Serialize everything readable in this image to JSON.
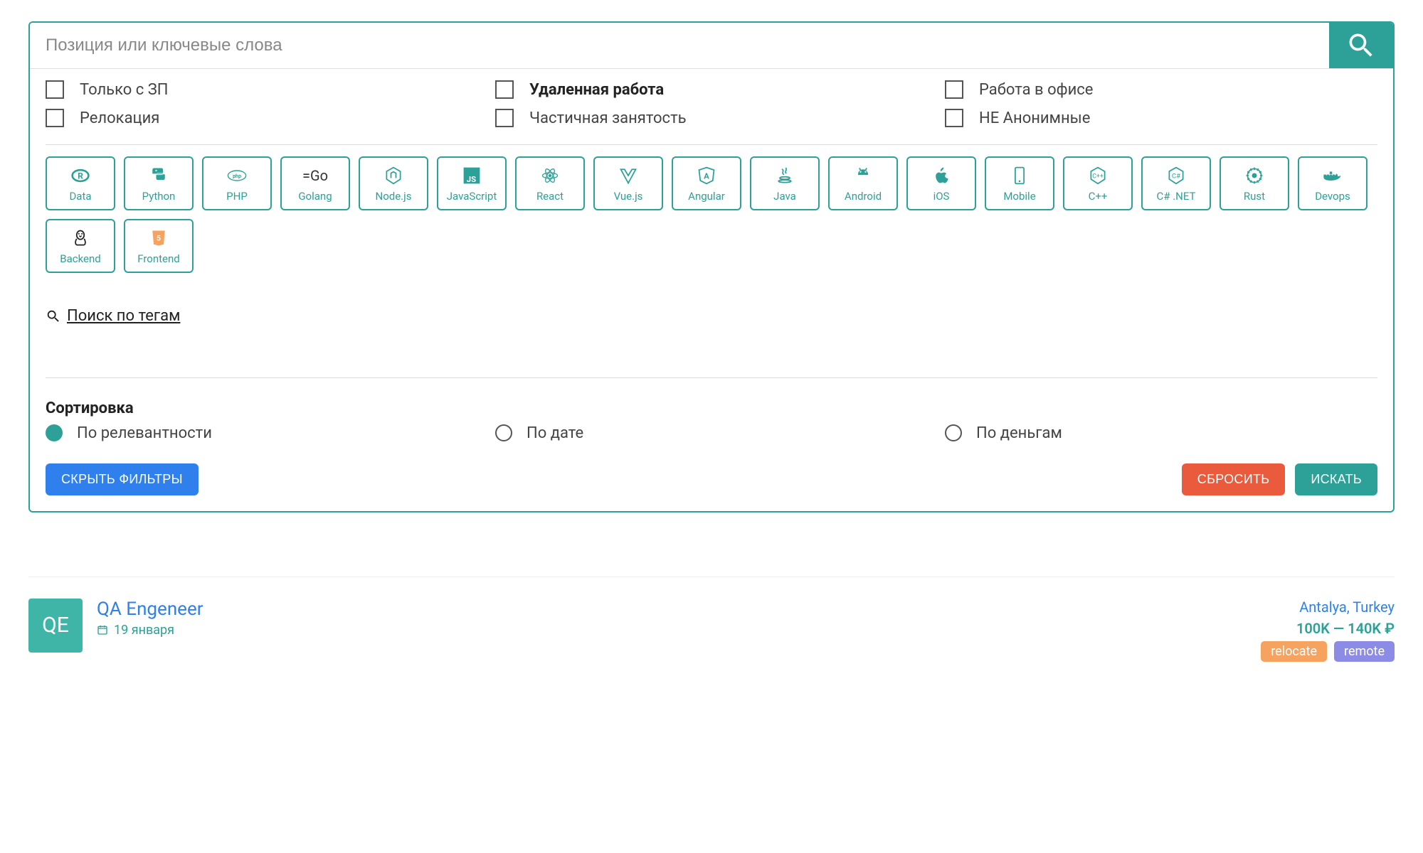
{
  "search": {
    "placeholder": "Позиция или ключевые слова"
  },
  "checkboxes": [
    {
      "label": "Только с ЗП",
      "bold": false
    },
    {
      "label": "Удаленная работа",
      "bold": true
    },
    {
      "label": "Работа в офисе",
      "bold": false
    },
    {
      "label": "Релокация",
      "bold": false
    },
    {
      "label": "Частичная занятость",
      "bold": false
    },
    {
      "label": "НЕ Анонимные",
      "bold": false
    }
  ],
  "tech": [
    {
      "label": "Data",
      "icon": "r"
    },
    {
      "label": "Python",
      "icon": "python"
    },
    {
      "label": "PHP",
      "icon": "php"
    },
    {
      "label": "Golang",
      "icon": "go"
    },
    {
      "label": "Node.js",
      "icon": "nodejs"
    },
    {
      "label": "JavaScript",
      "icon": "js"
    },
    {
      "label": "React",
      "icon": "react"
    },
    {
      "label": "Vue.js",
      "icon": "vue"
    },
    {
      "label": "Angular",
      "icon": "angular"
    },
    {
      "label": "Java",
      "icon": "java"
    },
    {
      "label": "Android",
      "icon": "android"
    },
    {
      "label": "iOS",
      "icon": "apple"
    },
    {
      "label": "Mobile",
      "icon": "mobile"
    },
    {
      "label": "C++",
      "icon": "cpp"
    },
    {
      "label": "C# .NET",
      "icon": "csharp"
    },
    {
      "label": "Rust",
      "icon": "rust"
    },
    {
      "label": "Devops",
      "icon": "devops"
    },
    {
      "label": "Backend",
      "icon": "linux"
    },
    {
      "label": "Frontend",
      "icon": "html5"
    }
  ],
  "tag_search_label": "Поиск по тегам",
  "sort": {
    "heading": "Сортировка",
    "options": [
      {
        "label": "По релевантности",
        "selected": true
      },
      {
        "label": "По дате",
        "selected": false
      },
      {
        "label": "По деньгам",
        "selected": false
      }
    ]
  },
  "buttons": {
    "hide_filters": "СКРЫТЬ ФИЛЬТРЫ",
    "reset": "СБРОСИТЬ",
    "search": "ИСКАТЬ"
  },
  "job": {
    "avatar_text": "QE",
    "title": "QA Engeneer",
    "date": "19 января",
    "location": "Antalya, Turkey",
    "salary": "100K — 140K ₽",
    "badges": [
      {
        "label": "relocate",
        "class": "badge-orange"
      },
      {
        "label": "remote",
        "class": "badge-purple"
      }
    ]
  },
  "colors": {
    "teal": "#2da197",
    "blue": "#2f80ed",
    "orange": "#e95b3c"
  }
}
